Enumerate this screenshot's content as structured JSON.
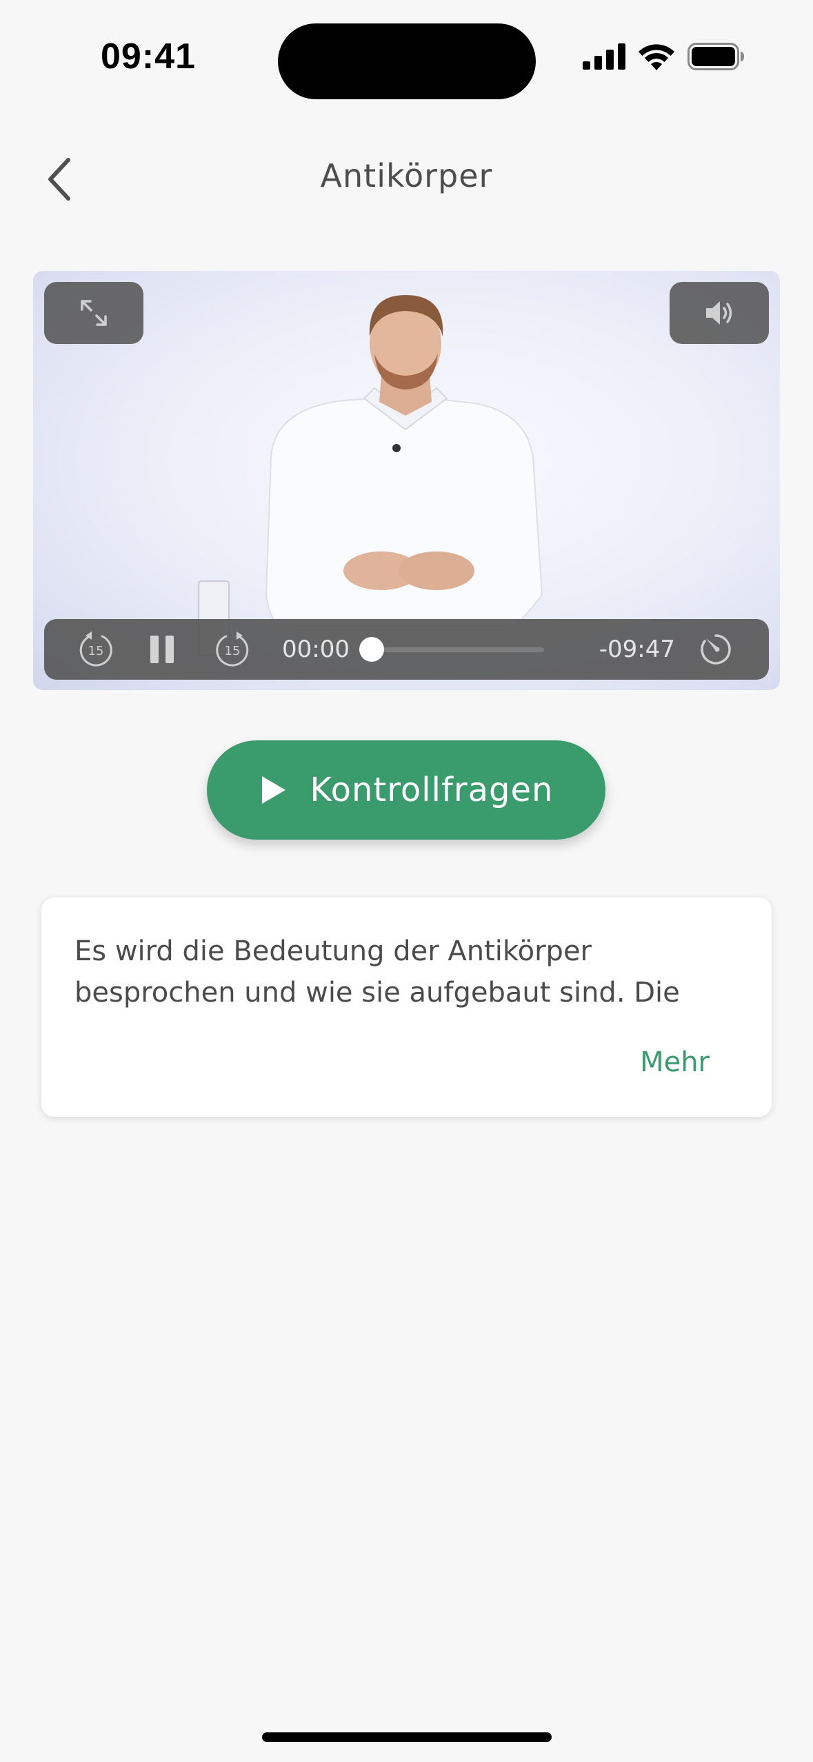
{
  "status_bar": {
    "time": "09:41"
  },
  "nav": {
    "title": "Antikörper",
    "back_icon": "chevron-left-icon"
  },
  "video": {
    "fullscreen_icon": "expand-arrows-icon",
    "volume_icon": "speaker-icon",
    "rewind_seconds": "15",
    "forward_seconds": "15",
    "elapsed": "00:00",
    "remaining": "-09:47",
    "progress": 0,
    "playback_state": "playing",
    "speed_icon": "gauge-icon"
  },
  "quiz_button": {
    "label": "Kontrollfragen",
    "icon": "play-icon"
  },
  "description": {
    "text": "Es wird die Bedeutung der Antikörper besprochen und wie sie aufgebaut sind. Die",
    "more_label": "Mehr"
  },
  "colors": {
    "accent": "#3a9b6c",
    "background": "#f7f7f7",
    "control_overlay": "#585858"
  }
}
